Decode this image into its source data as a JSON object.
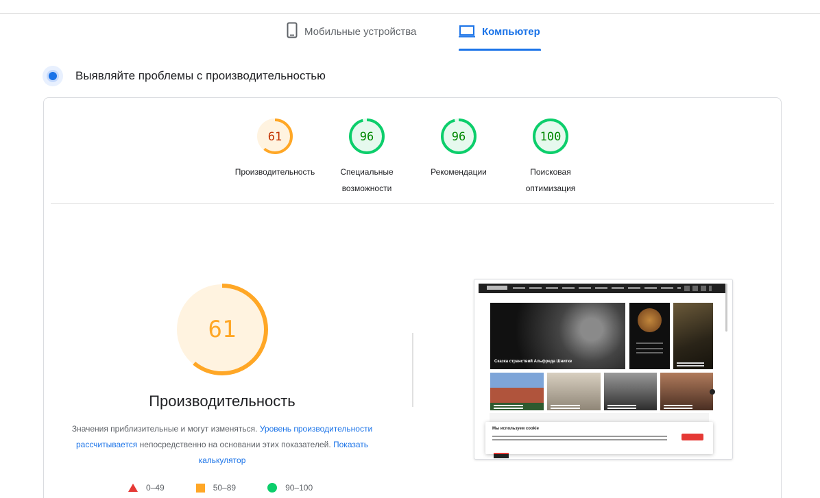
{
  "tabs": [
    {
      "label": "Мобильные устройства",
      "icon": "smartphone-icon",
      "active": false
    },
    {
      "label": "Компьютер",
      "icon": "desktop-icon",
      "active": true
    }
  ],
  "section": {
    "title": "Выявляйте проблемы с производительностью"
  },
  "scores": [
    {
      "value": "61",
      "label_lines": [
        "Производительность"
      ],
      "score": 61,
      "color": "#ffa726",
      "bg": "#fff3e0",
      "text_color": "#c33300"
    },
    {
      "value": "96",
      "label_lines": [
        "Специальные",
        "возможности"
      ],
      "score": 96,
      "color": "#0cce6b",
      "bg": "#e6f9ee",
      "text_color": "#008800"
    },
    {
      "value": "96",
      "label_lines": [
        "Рекомендации"
      ],
      "score": 96,
      "color": "#0cce6b",
      "bg": "#e6f9ee",
      "text_color": "#008800"
    },
    {
      "value": "100",
      "label_lines": [
        "Поисковая",
        "оптимизация"
      ],
      "score": 100,
      "color": "#0cce6b",
      "bg": "#e6f9ee",
      "text_color": "#008800"
    }
  ],
  "performance": {
    "score": "61",
    "score_value": 61,
    "title": "Производительность",
    "desc_1": "Значения приблизительные и могут изменяться.",
    "link_1": "Уровень производительности рассчитывается",
    "desc_2": "непосредственно на основании этих показателей.",
    "link_2": "Показать калькулятор"
  },
  "legend": [
    {
      "range": "0–49",
      "shape": "triangle",
      "color": "#e53935"
    },
    {
      "range": "50–89",
      "shape": "square",
      "color": "#ffa726"
    },
    {
      "range": "90–100",
      "shape": "circle",
      "color": "#0cce6b"
    }
  ],
  "thumbnail": {
    "hero_caption": "Сказка странствий Альфреда Шнитке",
    "cookie_title": "Мы используем cookie"
  }
}
